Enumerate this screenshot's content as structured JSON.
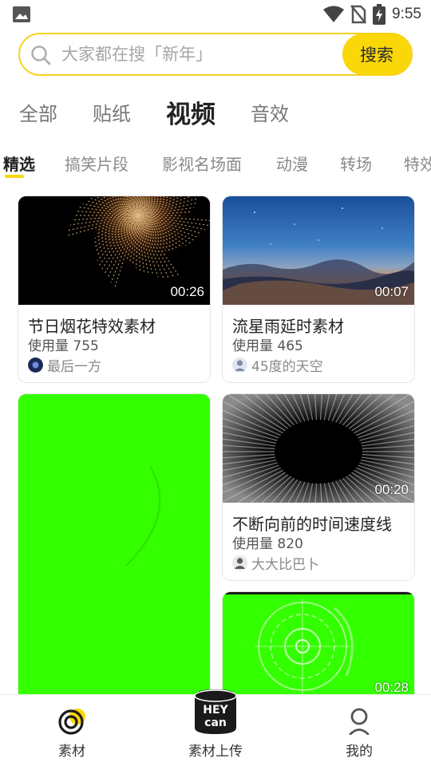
{
  "status_bar": {
    "time": "9:55",
    "icons": [
      "photo-icon",
      "wifi-icon",
      "no-sim-icon",
      "battery-charging-icon"
    ]
  },
  "search": {
    "placeholder": "大家都在搜「新年」",
    "button_label": "搜索",
    "icon": "search-icon"
  },
  "main_tabs": [
    {
      "label": "全部",
      "active": false
    },
    {
      "label": "贴纸",
      "active": false
    },
    {
      "label": "视频",
      "active": true
    },
    {
      "label": "音效",
      "active": false
    }
  ],
  "sub_tabs": [
    {
      "label": "精选",
      "active": true
    },
    {
      "label": "搞笑片段",
      "active": false
    },
    {
      "label": "影视名场面",
      "active": false
    },
    {
      "label": "动漫",
      "active": false
    },
    {
      "label": "转场",
      "active": false
    },
    {
      "label": "特效",
      "active": false
    }
  ],
  "cards": [
    {
      "title": "节日烟花特效素材",
      "usage": "使用量 755",
      "author": "最后一方",
      "duration": "00:26",
      "thumb": "fireworks"
    },
    {
      "title": "流星雨延时素材",
      "usage": "使用量 465",
      "author": "45度的天空",
      "duration": "00:07",
      "thumb": "sky-sunset"
    },
    {
      "title": "",
      "usage": "",
      "author": "",
      "duration": "",
      "thumb": "green-screen"
    },
    {
      "title": "不断向前的时间速度线",
      "usage": "使用量 820",
      "author": "大大比巴卜",
      "duration": "00:20",
      "thumb": "speed-lines"
    },
    {
      "title": "",
      "usage": "",
      "author": "",
      "duration": "00:28",
      "thumb": "green-hud"
    }
  ],
  "bottom_nav": [
    {
      "label": "素材",
      "icon": "material-icon",
      "active": true
    },
    {
      "label": "素材上传",
      "icon": "hey-can-upload-icon",
      "active": false,
      "icon_text": [
        "HEY",
        "can"
      ]
    },
    {
      "label": "我的",
      "icon": "profile-icon",
      "active": false
    }
  ],
  "colors": {
    "accent": "#f9d708",
    "search_border": "#f7d21e",
    "green_screen": "#33ff00"
  }
}
